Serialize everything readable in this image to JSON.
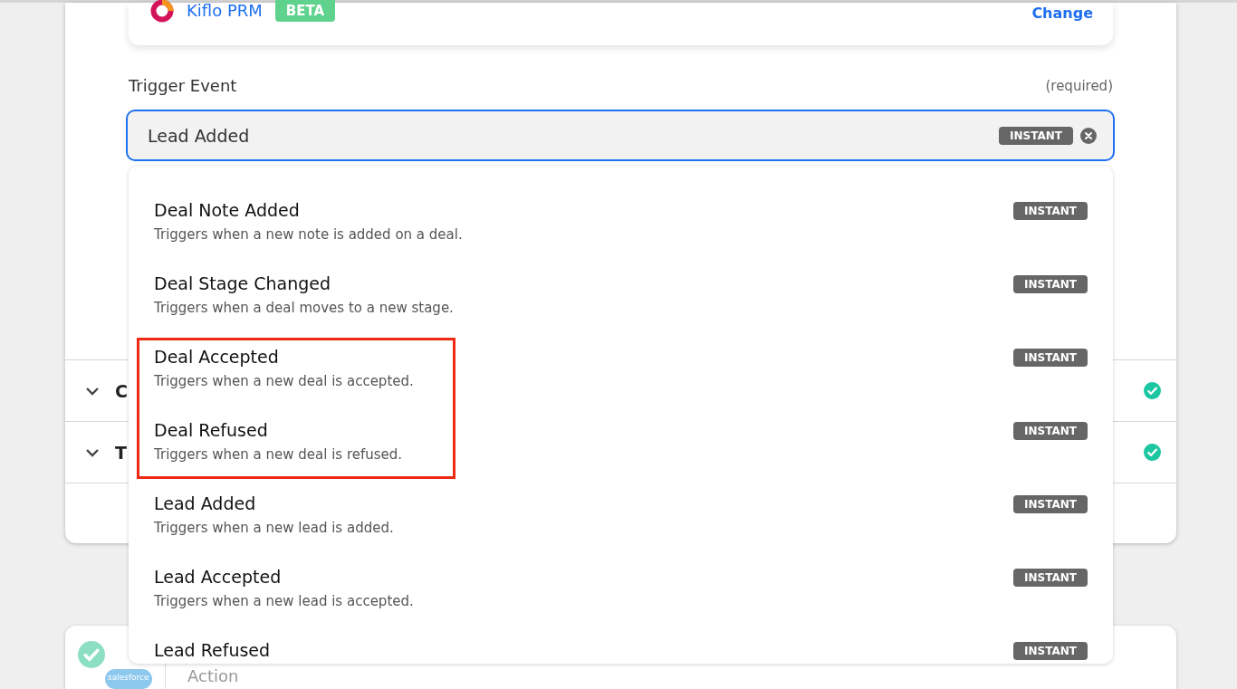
{
  "app": {
    "name": "Kiflo PRM",
    "badge": "BETA",
    "change_link": "Change"
  },
  "trigger_event": {
    "label": "Trigger Event",
    "required": "(required)",
    "value": "Lead Added",
    "badge": "INSTANT"
  },
  "sections": [
    {
      "label": "C",
      "checked": true
    },
    {
      "label": "T",
      "checked": true
    }
  ],
  "dropdown": {
    "items": [
      {
        "title": "Deal Note Added",
        "description": "Triggers when a new note is added on a deal.",
        "badge": "INSTANT",
        "highlighted": false
      },
      {
        "title": "Deal Stage Changed",
        "description": "Triggers when a deal moves to a new stage.",
        "badge": "INSTANT",
        "highlighted": false
      },
      {
        "title": "Deal Accepted",
        "description": "Triggers when a new deal is accepted.",
        "badge": "INSTANT",
        "highlighted": true
      },
      {
        "title": "Deal Refused",
        "description": "Triggers when a new deal is refused.",
        "badge": "INSTANT",
        "highlighted": true
      },
      {
        "title": "Lead Added",
        "description": "Triggers when a new lead is added.",
        "badge": "INSTANT",
        "highlighted": false
      },
      {
        "title": "Lead Accepted",
        "description": "Triggers when a new lead is accepted.",
        "badge": "INSTANT",
        "highlighted": false
      },
      {
        "title": "Lead Refused",
        "badge": "INSTANT",
        "highlighted": false
      }
    ]
  },
  "next_step": {
    "checked": true,
    "logo_text": "salesforce",
    "label": "Action"
  }
}
